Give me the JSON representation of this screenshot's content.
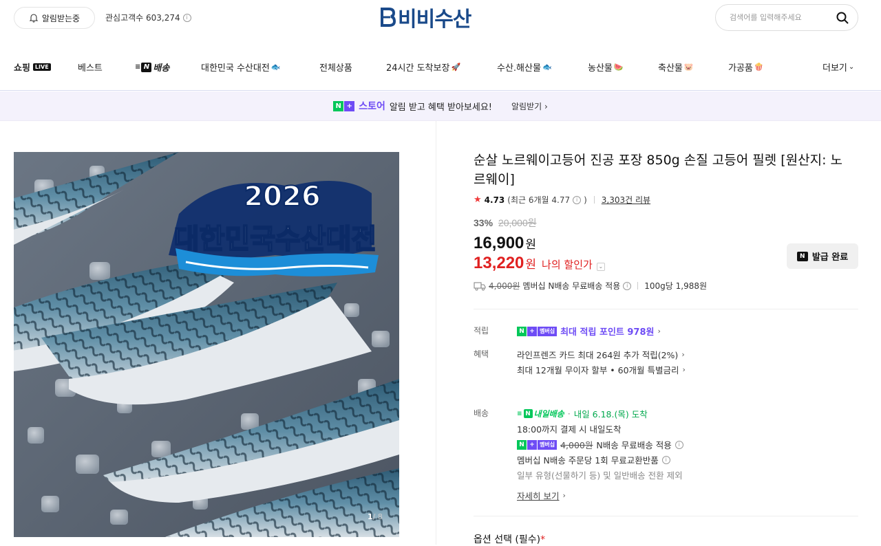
{
  "header": {
    "notify_label": "알림받는중",
    "fans_label": "관심고객수 603,274",
    "logo_text": "비비수산",
    "search_placeholder": "검색어를 입력해주세요"
  },
  "nav": {
    "items": [
      {
        "label": "쇼핑",
        "tag": "LIVE"
      },
      {
        "label": "베스트"
      },
      {
        "label": "배송"
      },
      {
        "label": "대한민국 수산대전",
        "emoji": "🐟"
      },
      {
        "label": "전체상품"
      },
      {
        "label": "24시간 도착보장",
        "emoji": "🚀"
      },
      {
        "label": "수산.해산물",
        "emoji": "🐟"
      },
      {
        "label": "농산물",
        "emoji": "🍉"
      },
      {
        "label": "축산물",
        "emoji": "🐷"
      },
      {
        "label": "가공품",
        "emoji": "🍿"
      }
    ],
    "more_label": "더보기"
  },
  "banner": {
    "store_word": "스토어",
    "message": "알림 받고 혜택 받아보세요!",
    "link_label": "알림받기"
  },
  "image": {
    "overlay_year": "2026",
    "overlay_text": "대한민국수산대전",
    "counter_current": "1",
    "counter_total": "/ 8"
  },
  "product": {
    "title": "순살 노르웨이고등어 진공 포장 850g 손질 고등어 필렛 [원산지: 노르웨이]",
    "rating": "4.73",
    "rating_recent": "(최근 6개월 4.77",
    "rating_recent_close": ")",
    "review_count": "3,303건 리뷰",
    "discount_pct": "33%",
    "original_price": "20,000원",
    "price": "16,900",
    "price_unit": "원",
    "my_price": "13,220",
    "my_price_unit": "원",
    "my_price_label": "나의 할인가",
    "coupon_label": "발급 완료",
    "shipping_orig": "4,000원",
    "shipping_text": "멤버십 N배송 무료배송 적용",
    "unit_price": "100g당 1,988원"
  },
  "benefits": {
    "point_label": "적립",
    "point_badge": "멤버십",
    "point_text": "최대 적립 포인트 978원",
    "benefit_label": "혜택",
    "benefit_line1": "라인프렌즈 카드 최대 264원 추가 적립(2%)",
    "benefit_line2": "최대 12개월 무이자 할부 • 60개월 특별금리"
  },
  "delivery": {
    "label": "배송",
    "logo_text": "내일배송",
    "arrival": "내일 6.18.(목) 도착",
    "cutoff": "18:00까지 결제 시 내일도착",
    "member_badge": "멤버십",
    "fee_orig": "4,000원",
    "fee_text": "N배송 무료배송 적용",
    "exchange": "멤버십 N배송 주문당 1회 무료교환반품",
    "exclude": "일부 유형(선물하기 등) 및 일반배송 전환 제외",
    "more_link": "자세히 보기"
  },
  "options": {
    "label": "옵션 선택 (필수)",
    "required_mark": "*"
  },
  "colors": {
    "accent_purple": "#6e4cf5",
    "naver_green": "#03c75a",
    "sale_red": "#e02020",
    "logo_navy": "#1a4a8a"
  }
}
